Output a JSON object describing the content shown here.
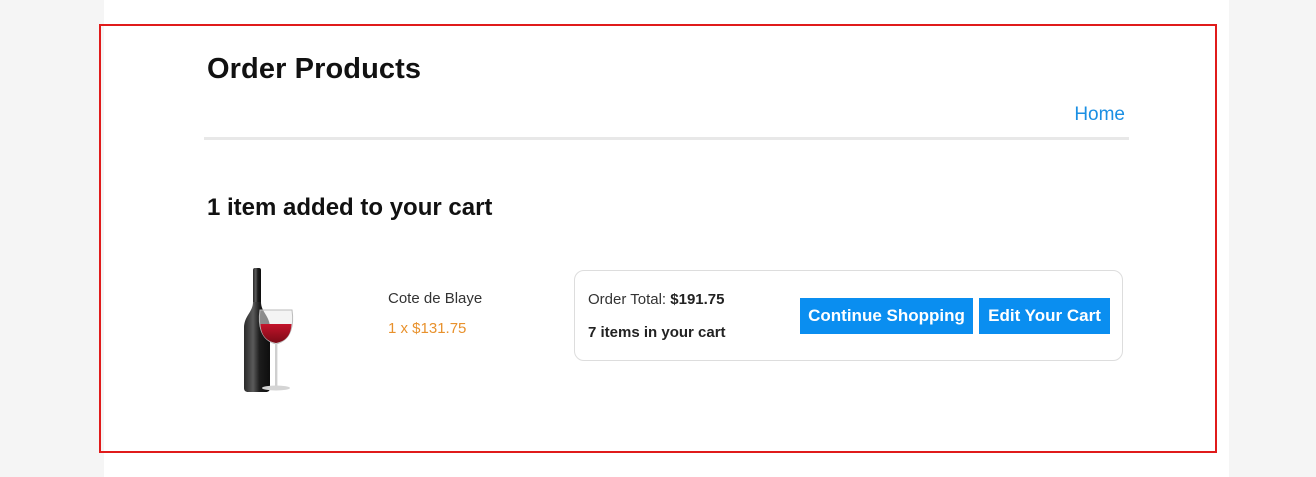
{
  "page": {
    "title": "Order Products",
    "nav_home": "Home"
  },
  "cart": {
    "heading": "1 item added to your cart",
    "item": {
      "name": "Cote de Blaye",
      "qty_price": "1 x $131.75",
      "image_icon": "wine-bottle-and-glass-icon"
    },
    "summary": {
      "total_label": "Order Total:",
      "total_value": "$191.75",
      "items_count": "7 items in your cart"
    },
    "buttons": {
      "continue": "Continue Shopping",
      "edit": "Edit Your Cart"
    }
  },
  "colors": {
    "accent": "#0a8ef0",
    "link": "#1a8fe3",
    "price": "#e8912c",
    "highlight_frame": "#e01b1b"
  }
}
